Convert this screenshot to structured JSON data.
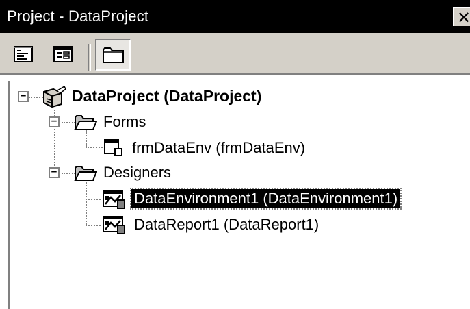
{
  "window": {
    "title": "Project - DataProject",
    "close_glyph": "✕"
  },
  "toolbar": {
    "buttons": [
      {
        "name": "view-code",
        "icon": "view-code-icon"
      },
      {
        "name": "view-object",
        "icon": "view-object-icon"
      },
      {
        "name": "toggle-folders",
        "icon": "folder-icon",
        "pressed": true
      }
    ]
  },
  "tree": {
    "root": {
      "label": "DataProject (DataProject)",
      "icon": "project-icon",
      "expander": "−"
    },
    "forms": {
      "label": "Forms",
      "icon": "folder-open-icon",
      "expander": "−"
    },
    "form_item": {
      "label": "frmDataEnv (frmDataEnv)",
      "icon": "form-icon"
    },
    "designers": {
      "label": "Designers",
      "icon": "folder-open-icon",
      "expander": "−"
    },
    "designer_items": [
      {
        "label": "DataEnvironment1 (DataEnvironment1)",
        "icon": "designer-icon",
        "selected": true
      },
      {
        "label": "DataReport1 (DataReport1)",
        "icon": "designer-icon",
        "selected": false
      }
    ]
  },
  "colors": {
    "titlebar_bg": "#000000",
    "toolbar_bg": "#d4d0c8",
    "selection_bg": "#000000"
  }
}
